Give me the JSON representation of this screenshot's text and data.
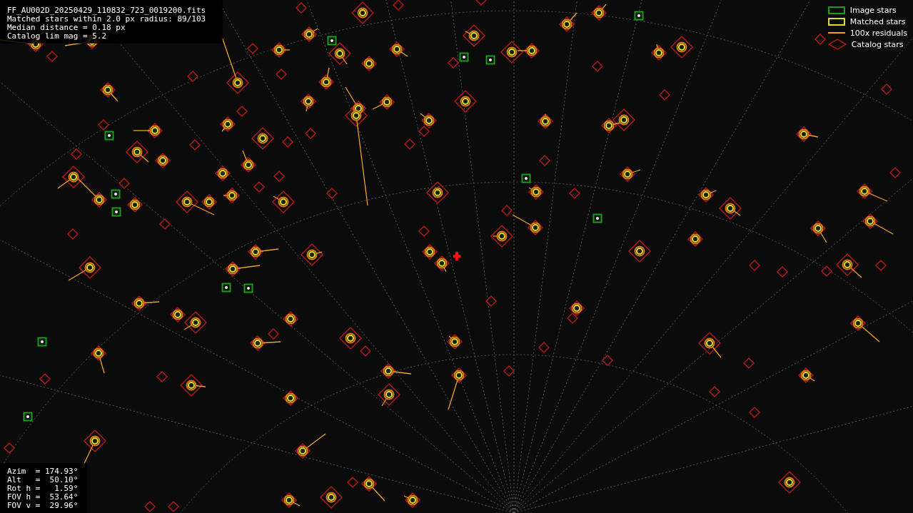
{
  "header": {
    "lines": [
      "FF_AU002D_20250429_110832_723_0019200.fits",
      "Matched stars within 2.0 px radius: 89/103",
      "Median distance = 0.18 px",
      "Catalog lim mag = 5.2"
    ]
  },
  "legend": [
    {
      "kind": "image",
      "label": "Image stars"
    },
    {
      "kind": "matched",
      "label": "Matched stars"
    },
    {
      "kind": "residual",
      "label": "100x residuals"
    },
    {
      "kind": "catalog",
      "label": "Catalog stars"
    }
  ],
  "pointing": {
    "lines": [
      "Azim  = 174.93°",
      "Alt   =  50.10°",
      "Rot h =   1.59°",
      "FOV h =  53.64°",
      "FOV v =  29.96°"
    ]
  }
}
